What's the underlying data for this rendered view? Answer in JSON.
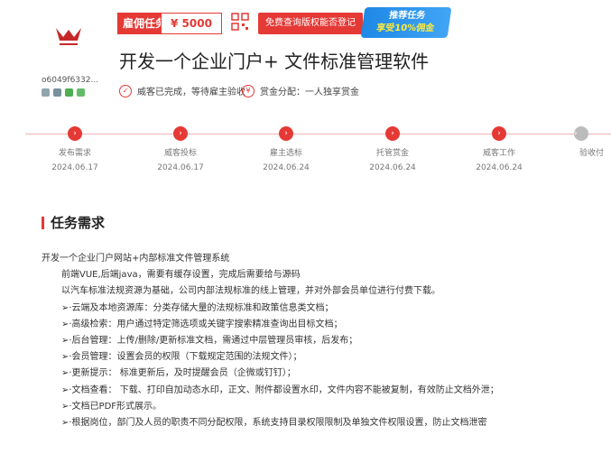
{
  "header": {
    "user_id": "o6049f6332...",
    "task_type": "雇佣任务",
    "price": "¥ 5000",
    "copyright_button": "免费查询版权能否登记",
    "promo_line1": "推荐任务",
    "promo_line2": "享受10%佣金",
    "title": "开发一个企业门户+ 文件标准管理软件",
    "status_text": "威客已完成，等待雇主验收",
    "reward_text": "赏金分配：一人独享赏金"
  },
  "timeline": [
    {
      "label": "发布需求",
      "date": "2024.06.17"
    },
    {
      "label": "威客投标",
      "date": "2024.06.17"
    },
    {
      "label": "雇主选标",
      "date": "2024.06.24"
    },
    {
      "label": "托管赏金",
      "date": "2024.06.24"
    },
    {
      "label": "威客工作",
      "date": "2024.06.24"
    },
    {
      "label": "验收付",
      "date": ""
    }
  ],
  "section": {
    "title": "任务需求"
  },
  "requirements": [
    "开发一个企业门户网站+内部标准文件管理系统",
    "前端VUE,后端java，需要有缓存设置，完成后需要给与源码",
    "以汽车标准法规资源为基础，公司内部法规标准的线上管理，并对外部会员单位进行付费下载。",
    "➢·云端及本地资源库：分类存储大量的法规标准和政策信息类文档；",
    "➢·高级检索：用户通过特定筛选项或关键字搜索精准查询出目标文档；",
    "➢·后台管理：上传/删除/更新标准文档，需通过中层管理员审核，后发布；",
    "➢·会员管理：设置会员的权限（下载规定范围的法规文件）；",
    "➢·更新提示：  标准更新后，及时提醒会员（企微或钉钉）；",
    "➢·文档查看：  下载、打印自加动态水印，正文、附件都设置水印，文件内容不能被复制，有效防止文档外泄；",
    "➢·文档已PDF形式展示。",
    "➢·根据岗位，部门及人员的职责不同分配权限，系统支持目录权限限制及单独文件权限设置，防止文档泄密"
  ],
  "colors": {
    "accent": "#e53935",
    "promo": "#1e88e5"
  }
}
